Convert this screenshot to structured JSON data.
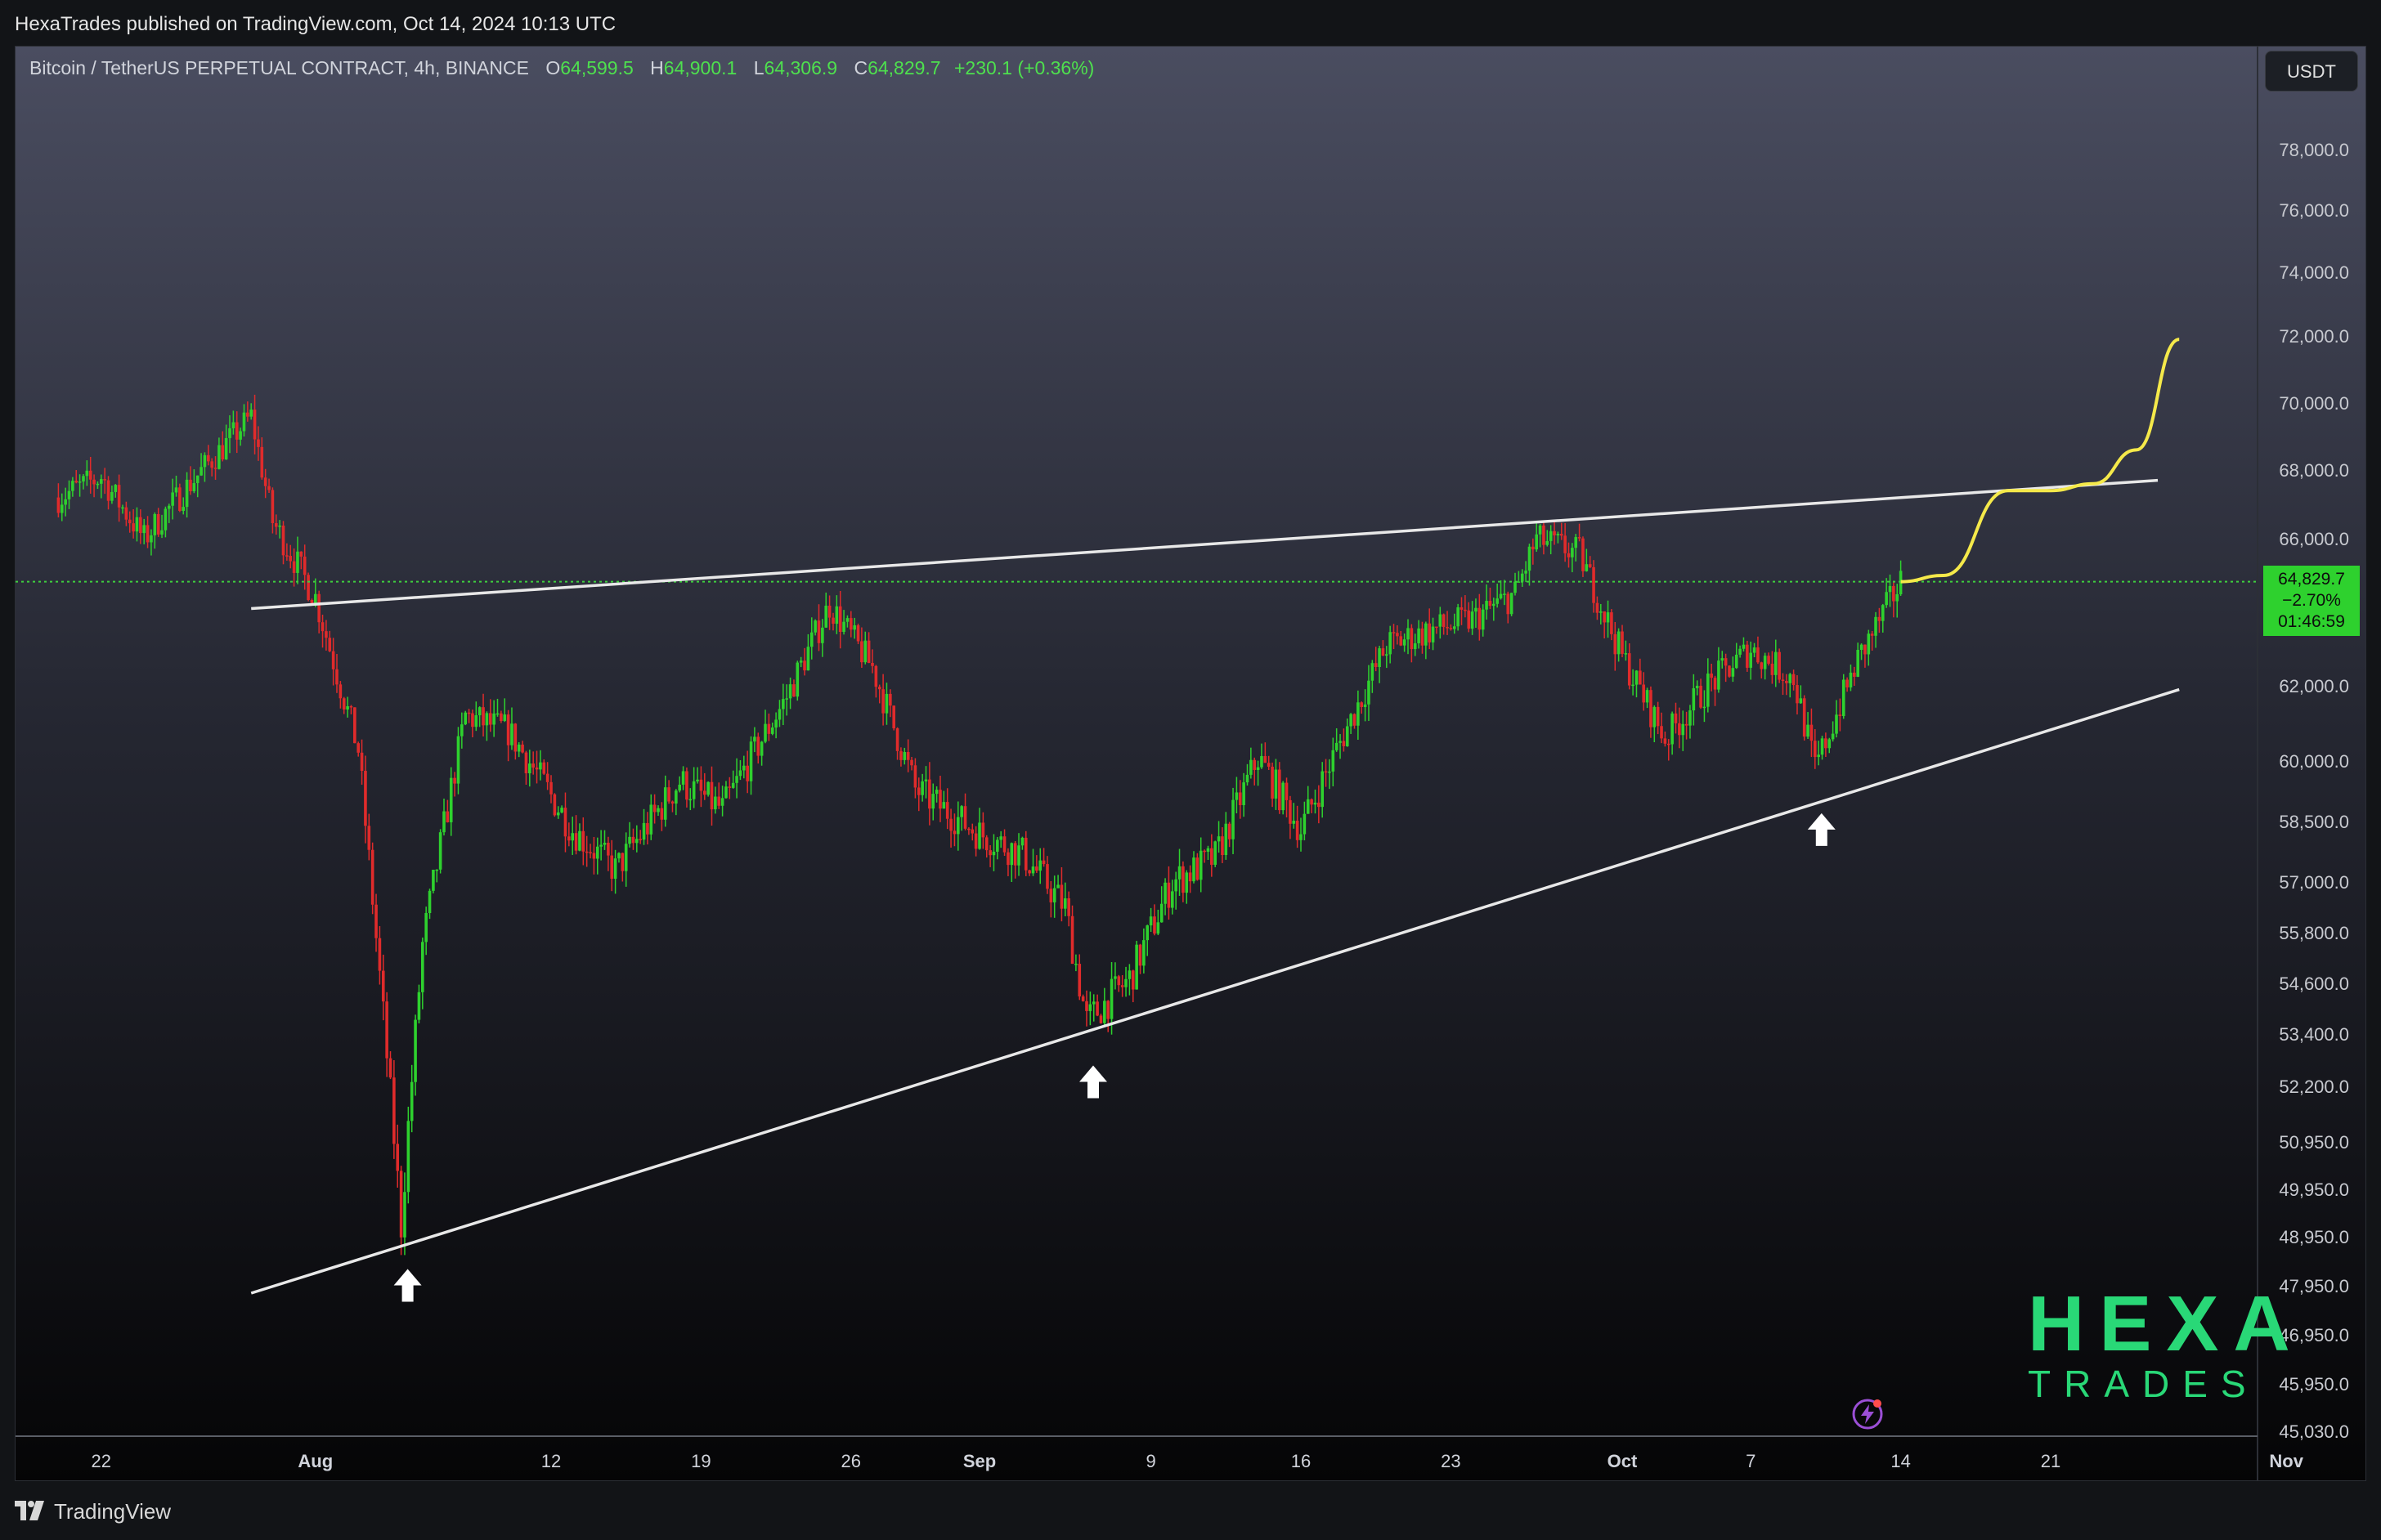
{
  "publisher_line": "HexaTrades published on TradingView.com, Oct 14, 2024 10:13 UTC",
  "legend": {
    "symbol": "Bitcoin / TetherUS PERPETUAL CONTRACT, 4h, BINANCE",
    "o_label": "O",
    "o_value": "64,599.5",
    "h_label": "H",
    "h_value": "64,900.1",
    "l_label": "L",
    "l_value": "64,306.9",
    "c_label": "C",
    "c_value": "64,829.7",
    "change": "+230.1 (+0.36%)"
  },
  "currency_button": "USDT",
  "price_tag": {
    "price": "64,829.7",
    "change_pct": "−2.70%",
    "countdown": "01:46:59"
  },
  "footer": {
    "brand_text": "TradingView"
  },
  "watermark": {
    "line1": "HEXA",
    "line2": "TRADES"
  },
  "colors": {
    "up": "#2ed12e",
    "down": "#e02b2b",
    "trendline": "#e8e8e8",
    "projection": "#f5e94a",
    "current_price_line": "#3ecf3e",
    "watermark": "#29d877"
  },
  "chart_data": {
    "type": "candlestick",
    "interval": "4h",
    "y_axis_labels": [
      "78,000.0",
      "76,000.0",
      "74,000.0",
      "72,000.0",
      "70,000.0",
      "68,000.0",
      "66,000.0",
      "62,000.0",
      "60,000.0",
      "58,500.0",
      "57,000.0",
      "55,800.0",
      "54,600.0",
      "53,400.0",
      "52,200.0",
      "50,950.0",
      "49,950.0",
      "48,950.0",
      "47,950.0",
      "46,950.0",
      "45,950.0",
      "45,030.0"
    ],
    "x_axis_labels": [
      "22",
      "Aug",
      "12",
      "19",
      "26",
      "Sep",
      "9",
      "16",
      "23",
      "Oct",
      "7",
      "14",
      "21",
      "Nov"
    ],
    "current_price": 64829.7,
    "ohlc_path": [
      {
        "date": "Jul 20",
        "price": 67200
      },
      {
        "date": "Jul 22",
        "price": 67800
      },
      {
        "date": "Jul 24",
        "price": 66000
      },
      {
        "date": "Jul 26",
        "price": 67500
      },
      {
        "date": "Jul 29",
        "price": 69600
      },
      {
        "date": "Jul 30",
        "price": 66500
      },
      {
        "date": "Aug 1",
        "price": 64400
      },
      {
        "date": "Aug 3",
        "price": 60300
      },
      {
        "date": "Aug 5",
        "price": 49200
      },
      {
        "date": "Aug 6",
        "price": 55500
      },
      {
        "date": "Aug 8",
        "price": 61200
      },
      {
        "date": "Aug 10",
        "price": 60800
      },
      {
        "date": "Aug 13",
        "price": 58300
      },
      {
        "date": "Aug 15",
        "price": 57300
      },
      {
        "date": "Aug 18",
        "price": 59500
      },
      {
        "date": "Aug 20",
        "price": 58800
      },
      {
        "date": "Aug 23",
        "price": 61700
      },
      {
        "date": "Aug 25",
        "price": 64200
      },
      {
        "date": "Aug 27",
        "price": 62500
      },
      {
        "date": "Aug 29",
        "price": 59300
      },
      {
        "date": "Sep 1",
        "price": 58200
      },
      {
        "date": "Sep 3",
        "price": 57700
      },
      {
        "date": "Sep 5",
        "price": 56400
      },
      {
        "date": "Sep 6",
        "price": 53700
      },
      {
        "date": "Sep 8",
        "price": 54700
      },
      {
        "date": "Sep 10",
        "price": 57000
      },
      {
        "date": "Sep 12",
        "price": 57600
      },
      {
        "date": "Sep 14",
        "price": 60100
      },
      {
        "date": "Sep 16",
        "price": 58300
      },
      {
        "date": "Sep 18",
        "price": 60700
      },
      {
        "date": "Sep 20",
        "price": 63100
      },
      {
        "date": "Sep 22",
        "price": 63500
      },
      {
        "date": "Sep 24",
        "price": 63800
      },
      {
        "date": "Sep 26",
        "price": 64500
      },
      {
        "date": "Sep 27",
        "price": 66000
      },
      {
        "date": "Sep 29",
        "price": 65600
      },
      {
        "date": "Oct 1",
        "price": 62800
      },
      {
        "date": "Oct 3",
        "price": 60600
      },
      {
        "date": "Oct 5",
        "price": 62000
      },
      {
        "date": "Oct 7",
        "price": 63000
      },
      {
        "date": "Oct 9",
        "price": 62200
      },
      {
        "date": "Oct 10",
        "price": 59800
      },
      {
        "date": "Oct 12",
        "price": 62700
      },
      {
        "date": "Oct 14",
        "price": 64829.7
      }
    ],
    "trendlines": [
      {
        "name": "",
        "from": {
          "date": "Jul 29",
          "price": 64100
        },
        "to": {
          "date": "Oct 26",
          "price": 67700
        }
      },
      {
        "name": "",
        "from": {
          "date": "Jul 29",
          "price": 47800
        },
        "to": {
          "date": "Oct 27",
          "price": 61900
        }
      }
    ],
    "projection": [
      {
        "date": "Oct 14",
        "price": 64829.7
      },
      {
        "date": "Oct 16",
        "price": 65000
      },
      {
        "date": "Oct 19",
        "price": 67400
      },
      {
        "date": "Oct 21",
        "price": 67400
      },
      {
        "date": "Oct 23",
        "price": 67600
      },
      {
        "date": "Oct 25",
        "price": 68600
      },
      {
        "date": "Oct 27",
        "price": 71900
      }
    ],
    "support_arrows": [
      "Aug 5",
      "Sep 6",
      "Oct 10"
    ],
    "grid": false
  }
}
